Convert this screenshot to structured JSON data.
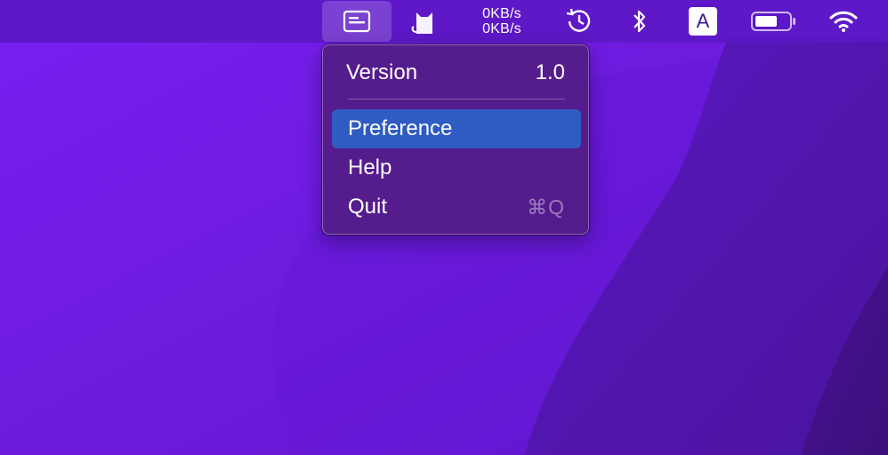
{
  "menubar": {
    "network": {
      "upload": "0KB/s",
      "download": "0KB/s"
    },
    "input_source": "A",
    "icons": [
      "app-status-icon",
      "cat-icon",
      "time-machine-icon",
      "bluetooth-icon",
      "battery-icon",
      "wifi-icon"
    ]
  },
  "menu": {
    "version_label": "Version",
    "version_value": "1.0",
    "items": [
      {
        "label": "Preference",
        "shortcut": "",
        "highlighted": true
      },
      {
        "label": "Help",
        "shortcut": ""
      },
      {
        "label": "Quit",
        "shortcut": "⌘Q"
      }
    ]
  },
  "colors": {
    "wallpaper_base": "#6a1fe0",
    "menubar": "#5c18c4",
    "menu_background": "#521c86",
    "highlight": "#2f5cc2"
  }
}
